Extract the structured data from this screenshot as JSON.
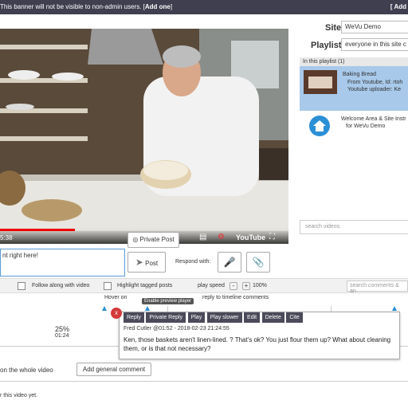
{
  "banner": {
    "text": "This banner will not be visible to non-admin users. [",
    "link": "Add one",
    "after": "]",
    "right_link": "[ Add"
  },
  "video": {
    "time": "5:38",
    "progress": 0.26,
    "youtube": "YouTube"
  },
  "sidebar": {
    "site_label": "Site",
    "site_value": "WeVu Demo",
    "playlist_label": "Playlist",
    "playlist_value": "everyone in this site c",
    "playlist_header": "In this playlist (1)",
    "items": [
      {
        "title": "Baking Bread",
        "line2": "From Youtube, Id: rtoh",
        "line3": "Youtube uploader: Ke"
      },
      {
        "title": "Welcome Area & Site Instr",
        "line2": "for WeVu Demo"
      }
    ],
    "search_placeholder": "search videos"
  },
  "composer": {
    "text": "nt right here!",
    "private_post": "Private Post",
    "post": "Post",
    "respond_with": "Respond with:"
  },
  "controls": {
    "follow": "Follow along with video",
    "highlight": "Highlight tagged posts",
    "play_speed": "play speed",
    "speed": "100%",
    "search_placeholder": "search comments & an"
  },
  "timeline": {
    "hint_a": "Hover on",
    "hint_b": "reply to timeline comments",
    "tooltip": "Enable preview player",
    "percent": "25%",
    "stamp": "01:24"
  },
  "comment": {
    "close": "x",
    "actions": [
      "Reply",
      "Private Reply",
      "Play",
      "Play slower",
      "Edit",
      "Delete",
      "Cite"
    ],
    "author": "Fred Cutler",
    "meta": "@01:52 - 2018-02-23 21:24:55",
    "body": "Ken, those baskets aren't linen-lined. ? That's ok? You just flour them up? What about cleaning them, or is that not necessary?"
  },
  "general": {
    "label": "on the whole video",
    "button": "Add general comment",
    "empty": "r this video yet."
  }
}
